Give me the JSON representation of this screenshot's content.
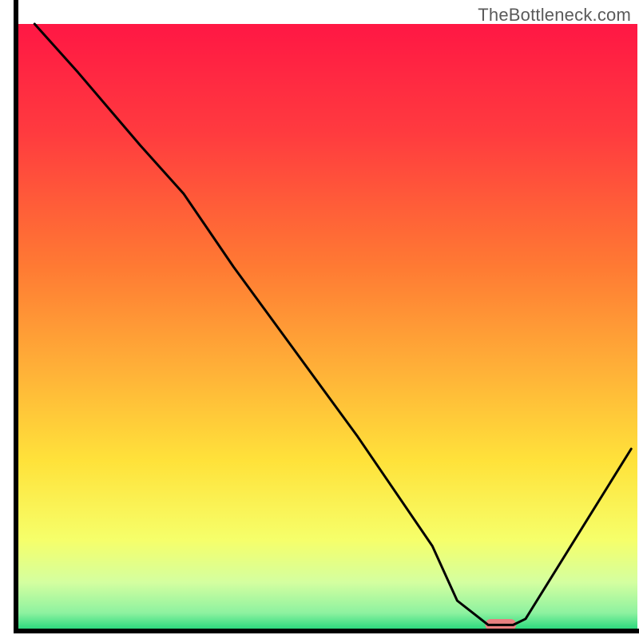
{
  "watermark": "TheBottleneck.com",
  "chart_data": {
    "type": "line",
    "title": "",
    "xlabel": "",
    "ylabel": "",
    "xlim": [
      0,
      100
    ],
    "ylim": [
      0,
      100
    ],
    "x": [
      3,
      10,
      20,
      27,
      35,
      45,
      55,
      67,
      71,
      76,
      80,
      82,
      99
    ],
    "values": [
      100,
      92,
      80,
      72,
      60,
      46,
      32,
      14,
      5,
      1,
      1,
      2,
      30
    ],
    "marker": {
      "x_center": 78,
      "width_pct": 5,
      "color": "#e88080"
    },
    "gradient_stops": [
      {
        "offset": 0.0,
        "color": "#ff1744"
      },
      {
        "offset": 0.18,
        "color": "#ff3b3f"
      },
      {
        "offset": 0.4,
        "color": "#ff7a33"
      },
      {
        "offset": 0.58,
        "color": "#ffb438"
      },
      {
        "offset": 0.72,
        "color": "#ffe23a"
      },
      {
        "offset": 0.85,
        "color": "#f6ff6a"
      },
      {
        "offset": 0.92,
        "color": "#d4ffa0"
      },
      {
        "offset": 0.97,
        "color": "#8ef2a0"
      },
      {
        "offset": 1.0,
        "color": "#1fd67a"
      }
    ],
    "axis_color": "#000000",
    "line_color": "#000000"
  }
}
